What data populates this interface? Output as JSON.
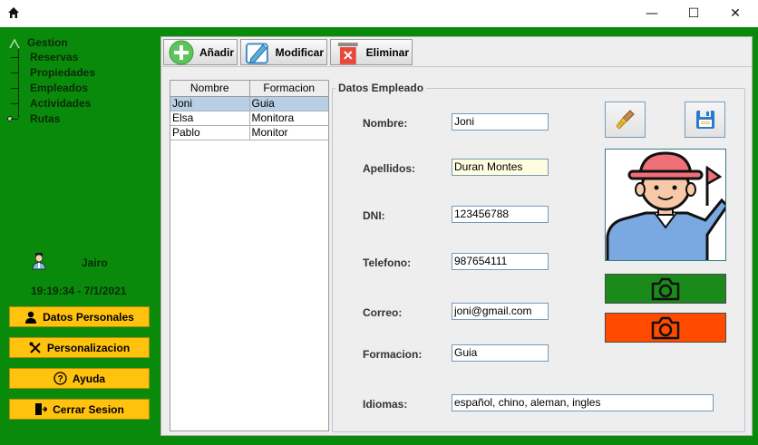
{
  "window": {
    "minimize_glyph": "—",
    "maximize_glyph": "☐",
    "close_glyph": "✕"
  },
  "sidebar": {
    "tree": {
      "root": "Gestion",
      "items": [
        "Reservas",
        "Propiedades",
        "Empleados",
        "Actividades",
        "Rutas"
      ]
    },
    "user": {
      "name": "Jairo",
      "datetime": "19:19:34 - 7/1/2021"
    },
    "buttons": {
      "datos_personales": "Datos Personales",
      "personalizacion": "Personalizacion",
      "ayuda": "Ayuda",
      "cerrar_sesion": "Cerrar Sesion"
    }
  },
  "toolbar": {
    "add": "Añadir",
    "modify": "Modificar",
    "delete": "Eliminar"
  },
  "table": {
    "headers": [
      "Nombre",
      "Formacion"
    ],
    "rows": [
      [
        "Joni",
        "Guia"
      ],
      [
        "Elsa",
        "Monitora"
      ],
      [
        "Pablo",
        "Monitor"
      ]
    ],
    "selected_row": 0
  },
  "form": {
    "legend": "Datos Empleado",
    "labels": {
      "nombre": "Nombre:",
      "apellidos": "Apellidos:",
      "dni": "DNI:",
      "telefono": "Telefono:",
      "correo": "Correo:",
      "formacion": "Formacion:",
      "idiomas": "Idiomas:"
    },
    "values": {
      "nombre": "Joni",
      "apellidos": "Duran Montes",
      "dni": "123456788",
      "telefono": "987654111",
      "correo": "joni@gmail.com",
      "formacion": "Guia",
      "idiomas": "español, chino, aleman, ingles"
    },
    "icons": {
      "clear": "broom-icon",
      "save": "floppy-disk-icon",
      "camera": "camera-icon"
    }
  },
  "colors": {
    "sidebar_green": "#0a8a0a",
    "button_yellow": "#ffc20e",
    "camera_green": "#1a8a1a",
    "camera_red": "#ff4a00",
    "selection_blue": "#b8cfe5"
  }
}
